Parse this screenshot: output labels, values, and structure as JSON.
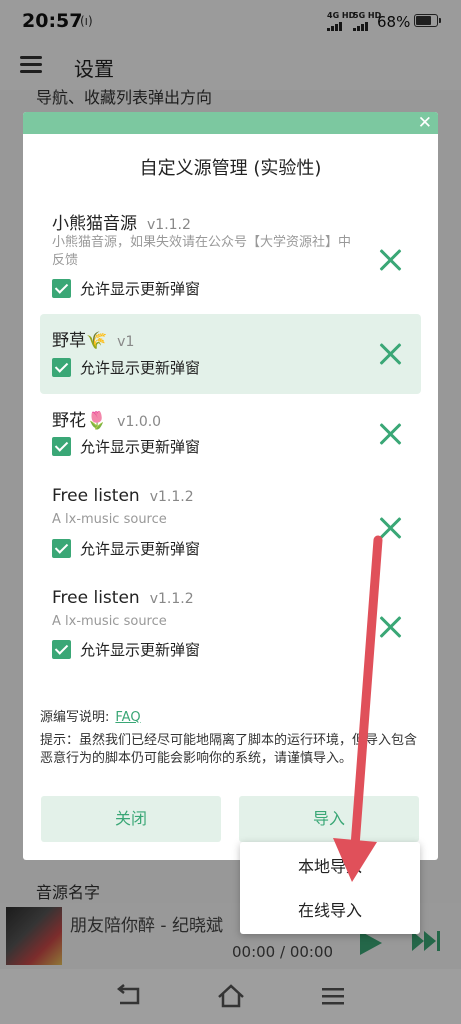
{
  "status_bar": {
    "time": "20:57",
    "nfc_glyph": "(ı)",
    "signal_1": "4G HD",
    "signal_2": "5G HD",
    "battery": "68%",
    "battery_level": 0.68
  },
  "header": {
    "title": "设置",
    "menu_icon": "hamburger-icon"
  },
  "background": {
    "subtext": "导航、收藏列表弹出方向",
    "section_title": "音源名字"
  },
  "dialog": {
    "title": "自定义源管理 (实验性)",
    "close_icon": "close-icon",
    "sources": [
      {
        "name": "小熊猫音源",
        "version": "v1.1.2",
        "description": "小熊猫音源，如果失效请在公众号【大学资源社】中反馈",
        "checkbox_label": "允许显示更新弹窗",
        "checked": true,
        "selected": false
      },
      {
        "name": "野草🌾",
        "version": "v1",
        "description": "",
        "checkbox_label": "允许显示更新弹窗",
        "checked": true,
        "selected": true
      },
      {
        "name": "野花🌷",
        "version": "v1.0.0",
        "description": "",
        "checkbox_label": "允许显示更新弹窗",
        "checked": true,
        "selected": false
      },
      {
        "name": "Free listen",
        "version": "v1.1.2",
        "description": "A lx-music source",
        "checkbox_label": "允许显示更新弹窗",
        "checked": true,
        "selected": false
      },
      {
        "name": "Free listen",
        "version": "v1.1.2",
        "description": "A lx-music source",
        "checkbox_label": "允许显示更新弹窗",
        "checked": true,
        "selected": false
      }
    ],
    "help_label": "源编写说明:",
    "help_link": "FAQ",
    "tip": "提示：虽然我们已经尽可能地隔离了脚本的运行环境，但导入包含恶意行为的脚本仍可能会影响你的系统，请谨慎导入。",
    "close_button": "关闭",
    "import_button": "导入"
  },
  "import_menu": {
    "items": [
      "本地导入",
      "在线导入"
    ]
  },
  "player": {
    "song": "朋友陪你醉 - 纪晓斌",
    "time": "00:00 / 00:00"
  },
  "colors": {
    "accent": "#3aa776",
    "header_bar": "#7cc8a0",
    "selected_bg": "#e3f1e9",
    "annotation_arrow": "#e0505a"
  }
}
